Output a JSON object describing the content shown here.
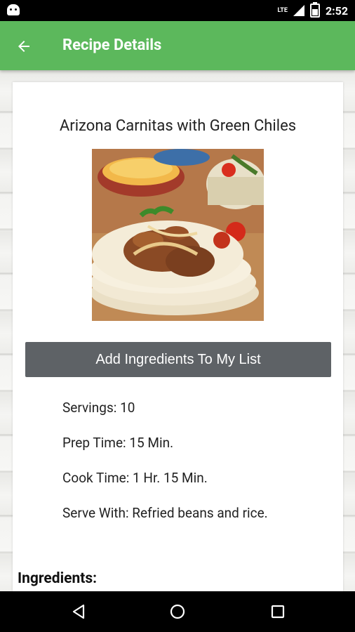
{
  "status_bar": {
    "network": "LTE",
    "time": "2:52"
  },
  "app_bar": {
    "title": "Recipe Details"
  },
  "recipe": {
    "title": "Arizona Carnitas with Green Chiles",
    "add_button_label": "Add Ingredients To My List",
    "details": [
      "Servings: 10",
      "Prep Time: 15 Min.",
      "Cook Time: 1 Hr. 15 Min.",
      "Serve With: Refried beans and rice."
    ],
    "ingredients_heading": "Ingredients:"
  },
  "icons": {
    "back": "arrow-back-icon",
    "nav_back": "triangle-back-icon",
    "nav_home": "circle-home-icon",
    "nav_recents": "square-recents-icon"
  },
  "colors": {
    "app_bar": "#5cb85c",
    "button": "#5e6266"
  }
}
